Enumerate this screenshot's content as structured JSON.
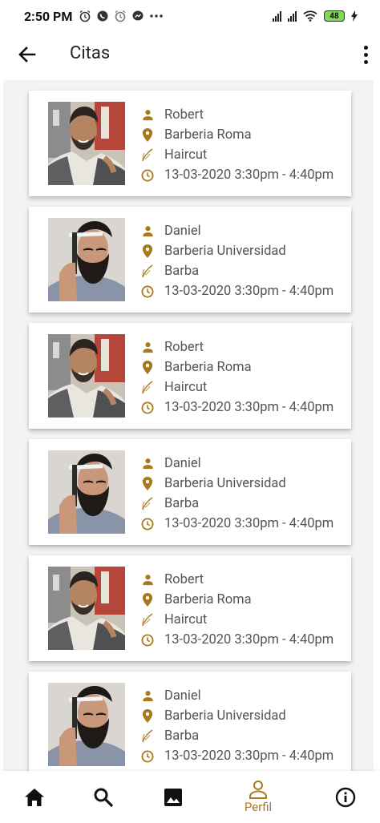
{
  "status_bar": {
    "time": "2:50 PM",
    "battery": "48",
    "left_icons": [
      "alarm-icon",
      "whatsapp-icon",
      "alarm-icon",
      "messenger-icon",
      "more-dots-icon"
    ]
  },
  "app_bar": {
    "title": "Citas"
  },
  "colors": {
    "accent": "#a87a1e",
    "card_bg": "#ffffff",
    "list_bg": "#f3f3f3"
  },
  "appointments": [
    {
      "client": "Robert",
      "shop": "Barberia Roma",
      "service": "Haircut",
      "datetime": "13-03-2020 3:30pm - 4:40pm"
    },
    {
      "client": "Daniel",
      "shop": "Barberia Universidad",
      "service": "Barba",
      "datetime": "13-03-2020 3:30pm - 4:40pm"
    },
    {
      "client": "Robert",
      "shop": "Barberia Roma",
      "service": "Haircut",
      "datetime": "13-03-2020 3:30pm - 4:40pm"
    },
    {
      "client": "Daniel",
      "shop": "Barberia Universidad",
      "service": "Barba",
      "datetime": "13-03-2020 3:30pm - 4:40pm"
    },
    {
      "client": "Robert",
      "shop": "Barberia Roma",
      "service": "Haircut",
      "datetime": "13-03-2020 3:30pm - 4:40pm"
    },
    {
      "client": "Daniel",
      "shop": "Barberia Universidad",
      "service": "Barba",
      "datetime": "13-03-2020 3:30pm - 4:40pm"
    }
  ],
  "bottom_nav": {
    "items": [
      {
        "icon": "home-icon",
        "label": ""
      },
      {
        "icon": "search-icon",
        "label": ""
      },
      {
        "icon": "image-icon",
        "label": ""
      },
      {
        "icon": "person-icon",
        "label": "Perfil",
        "active": true
      },
      {
        "icon": "info-icon",
        "label": ""
      }
    ]
  }
}
